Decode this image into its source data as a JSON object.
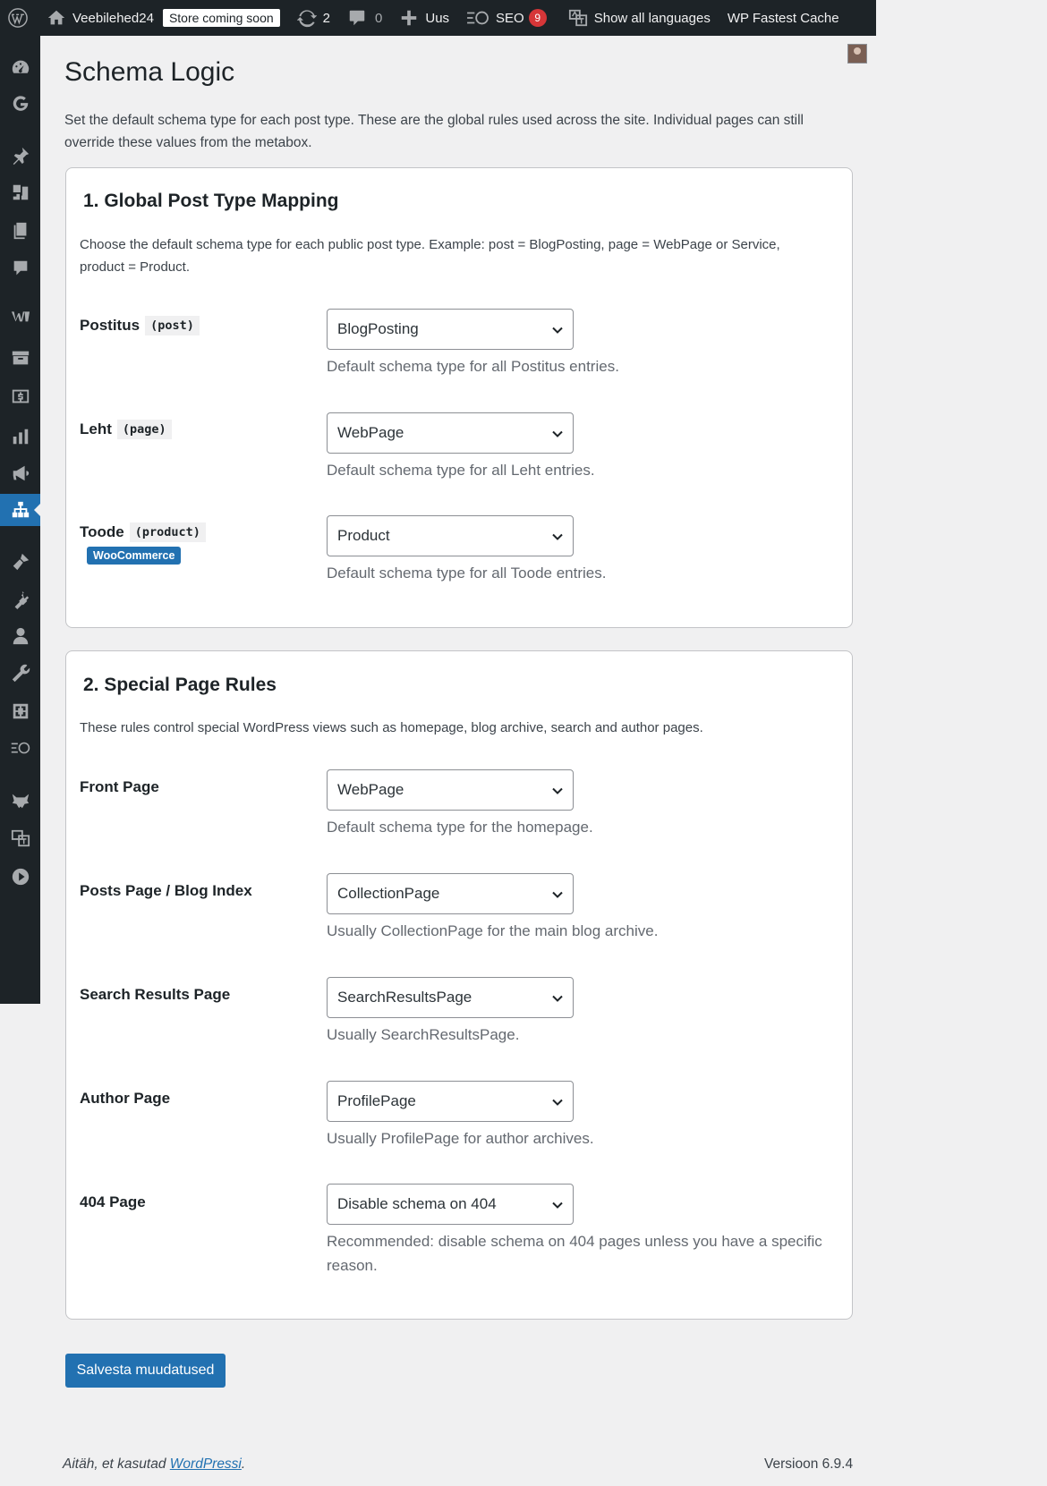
{
  "adminbar": {
    "site_name": "Veebilehed24",
    "store_status": "Store coming soon",
    "updates_count": "2",
    "comments_count": "0",
    "new_label": "Uus",
    "seo_label": "SEO",
    "seo_badge": "9",
    "languages_label": "Show all languages",
    "cache_label": "WP Fastest Cache"
  },
  "page": {
    "title": "Schema Logic",
    "intro": "Set the default schema type for each post type. These are the global rules used across the site. Individual pages can still override these values from the metabox."
  },
  "section1": {
    "heading": "1. Global Post Type Mapping",
    "description": "Choose the default schema type for each public post type. Example: post = BlogPosting, page = WebPage or Service, product = Product.",
    "rows": [
      {
        "label": "Postitus",
        "code": "(post)",
        "value": "BlogPosting",
        "help": "Default schema type for all Postitus entries."
      },
      {
        "label": "Leht",
        "code": "(page)",
        "value": "WebPage",
        "help": "Default schema type for all Leht entries."
      },
      {
        "label": "Toode",
        "code": "(product)",
        "badge": "WooCommerce",
        "value": "Product",
        "help": "Default schema type for all Toode entries."
      }
    ]
  },
  "section2": {
    "heading": "2. Special Page Rules",
    "description": "These rules control special WordPress views such as homepage, blog archive, search and author pages.",
    "rows": [
      {
        "label": "Front Page",
        "value": "WebPage",
        "help": "Default schema type for the homepage."
      },
      {
        "label": "Posts Page / Blog Index",
        "value": "CollectionPage",
        "help": "Usually CollectionPage for the main blog archive."
      },
      {
        "label": "Search Results Page",
        "value": "SearchResultsPage",
        "help": "Usually SearchResultsPage."
      },
      {
        "label": "Author Page",
        "value": "ProfilePage",
        "help": "Usually ProfilePage for author archives."
      },
      {
        "label": "404 Page",
        "value": "Disable schema on 404",
        "help": "Recommended: disable schema on 404 pages unless you have a specific reason."
      }
    ]
  },
  "save_button": "Salvesta muudatused",
  "footer": {
    "thanks_prefix": "Aitäh, et kasutad",
    "wordpress_link": "WordPressi",
    "thanks_suffix": ".",
    "version": "Versioon 6.9.4"
  },
  "colors": {
    "primary": "#2271b1",
    "adminbar_bg": "#1d2327",
    "badge_red": "#d63638"
  },
  "menu_icons": [
    "dashboard-icon",
    "google-icon",
    "posts-pin-icon",
    "media-icon",
    "pages-icon",
    "comments-icon",
    "woocommerce-icon",
    "products-icon",
    "payments-icon",
    "analytics-icon",
    "marketing-icon",
    "schema-logic-icon",
    "appearance-icon",
    "plugins-icon",
    "users-icon",
    "tools-icon",
    "settings-icon",
    "seo-icon",
    "wolf-icon",
    "translate-icon",
    "media-play-icon"
  ]
}
